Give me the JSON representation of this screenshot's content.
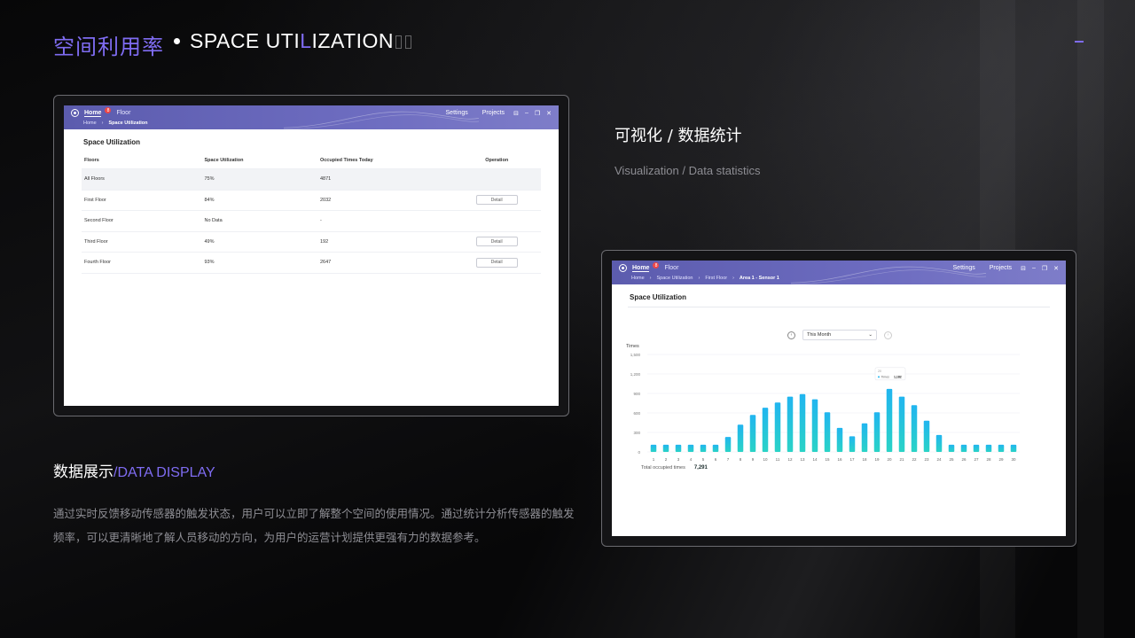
{
  "header": {
    "title_cn": "空间利用率",
    "title_en_pre": "SPACE UTI",
    "title_en_hl": "L",
    "title_en_post": "IZATION"
  },
  "colors": {
    "accent": "#7f6cf2",
    "appbar": "#6766b8",
    "bar_top": "#21b5f0",
    "bar_bottom": "#2ad3c6"
  },
  "left_app": {
    "nav": {
      "home": "Home",
      "badge": "8",
      "floor": "Floor",
      "settings": "Settings",
      "projects": "Projects"
    },
    "breadcrumb": {
      "home": "Home",
      "current": "Space Utilization"
    },
    "panel_title": "Space Utilization",
    "table": {
      "headers": [
        "Floors",
        "Space Utilization",
        "Occupied Times Today",
        "Operation"
      ],
      "rows": [
        {
          "floor": "All Floors",
          "util": "75%",
          "times": "4871",
          "action": ""
        },
        {
          "floor": "First Floor",
          "util": "84%",
          "times": "2032",
          "action": "Detail"
        },
        {
          "floor": "Second Floor",
          "util": "No Data",
          "times": "-",
          "action": ""
        },
        {
          "floor": "Third Floor",
          "util": "49%",
          "times": "192",
          "action": "Detail"
        },
        {
          "floor": "Fourth Floor",
          "util": "93%",
          "times": "2647",
          "action": "Detail"
        }
      ]
    }
  },
  "right_app": {
    "nav": {
      "home": "Home",
      "badge": "8",
      "floor": "Floor",
      "settings": "Settings",
      "projects": "Projects"
    },
    "breadcrumb": [
      "Home",
      "Space Utilization",
      "First Floor",
      "Area 1 - Sensor 1"
    ],
    "panel_title": "Space Utilization",
    "period_select": "This Month",
    "total_label": "Total occupied times",
    "total_value": "7,291"
  },
  "chart_data": {
    "type": "bar",
    "ylabel": "Times",
    "ylim": [
      0,
      1500
    ],
    "yticks": [
      "0",
      "300",
      "600",
      "900",
      "1,200",
      "1,500"
    ],
    "categories": [
      "1",
      "2",
      "3",
      "4",
      "5",
      "6",
      "7",
      "8",
      "9",
      "10",
      "11",
      "12",
      "13",
      "14",
      "15",
      "16",
      "17",
      "18",
      "19",
      "20",
      "21",
      "22",
      "23",
      "24",
      "25",
      "26",
      "27",
      "28",
      "29",
      "30"
    ],
    "series": [
      {
        "name": "Times",
        "values": [
          110,
          110,
          110,
          110,
          110,
          110,
          230,
          420,
          570,
          680,
          760,
          850,
          890,
          810,
          610,
          370,
          240,
          440,
          610,
          970,
          850,
          720,
          480,
          260,
          110,
          110,
          110,
          110,
          110,
          110
        ]
      }
    ],
    "tooltip": {
      "category": "20",
      "label": "Times",
      "value": "1,182"
    },
    "grid": true
  },
  "right_texts": {
    "section_cn": "可视化 / 数据统计",
    "section_en": "Visualization / Data statistics"
  },
  "bottom": {
    "display_cn": "数据展示",
    "display_en": "/DATA DISPLAY",
    "description": "通过实时反馈移动传感器的触发状态，用户可以立即了解整个空间的使用情况。通过统计分析传感器的触发频率，可以更清晰地了解人员移动的方向，为用户的运营计划提供更强有力的数据参考。"
  }
}
